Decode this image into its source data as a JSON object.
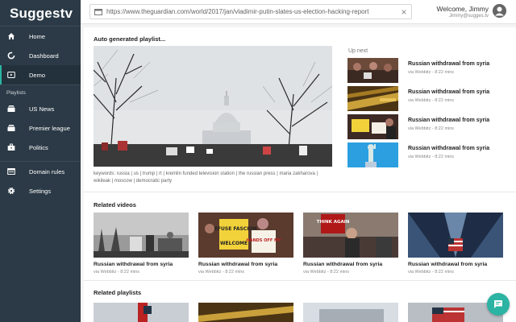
{
  "app": {
    "brand": "Suggestv"
  },
  "sidebar": {
    "items": [
      {
        "label": "Home",
        "icon": "home-icon"
      },
      {
        "label": "Dashboard",
        "icon": "dashboard-icon"
      },
      {
        "label": "Demo",
        "icon": "video-icon",
        "active": true
      }
    ],
    "playlists_label": "Playlists",
    "playlists": [
      {
        "label": "US News",
        "icon": "playlist-icon"
      },
      {
        "label": "Premier league",
        "icon": "playlist-icon"
      },
      {
        "label": "Politics",
        "icon": "briefcase-icon"
      }
    ],
    "bottom": [
      {
        "label": "Domain rules",
        "icon": "rules-icon"
      },
      {
        "label": "Settings",
        "icon": "gear-icon"
      }
    ]
  },
  "topbar": {
    "url": "https://www.theguardian.com/world/2017/jan/vladimir-putin-slates-us-election-hacking-report",
    "clear": "×",
    "welcome": "Welcome, Jimmy",
    "email": "Jimmy@sugges.tv"
  },
  "main": {
    "auto_playlist_title": "Auto generated playlist...",
    "keywords": "keywords: russia | us | trump | rt | kremlin funded television station | the russian press | maria zakharova | wikileak | moscow | democratic party",
    "upnext_label": "Up next",
    "upnext": [
      {
        "title": "Russian withdrawal from syria",
        "meta": "via Webbitz - 8:22 mins"
      },
      {
        "title": "Russian withdrawal from syria",
        "meta": "via Webbitz - 8:22 mins"
      },
      {
        "title": "Russian withdrawal from syria",
        "meta": "via Webbitz - 8:22 mins"
      },
      {
        "title": "Russian withdrawal from syria",
        "meta": "via Webbitz - 8:22 mins"
      }
    ],
    "related_videos_title": "Related videos",
    "related_videos": [
      {
        "title": "Russian withdrawal from syria",
        "meta": "via Webbitz - 8:22 mins"
      },
      {
        "title": "Russian withdrawal from syria",
        "meta": "via Webbitz - 8:22 mins"
      },
      {
        "title": "Russian withdrawal from syria",
        "meta": "via Webbitz - 8:22 mins"
      },
      {
        "title": "Russian withdrawal from syria",
        "meta": "via Webbitz - 8:22 mins"
      }
    ],
    "related_playlists_title": "Related playlists",
    "protest_signs": {
      "sign1": "REFUSE FASCISM",
      "sign2": "HANDS OFF MY",
      "sign3": "THINK AGAIN",
      "sign4": "WELCOME"
    }
  },
  "colors": {
    "sidebar": "#2b3a46",
    "accent": "#2bb3a3"
  },
  "fab": {
    "icon": "chat-icon"
  }
}
